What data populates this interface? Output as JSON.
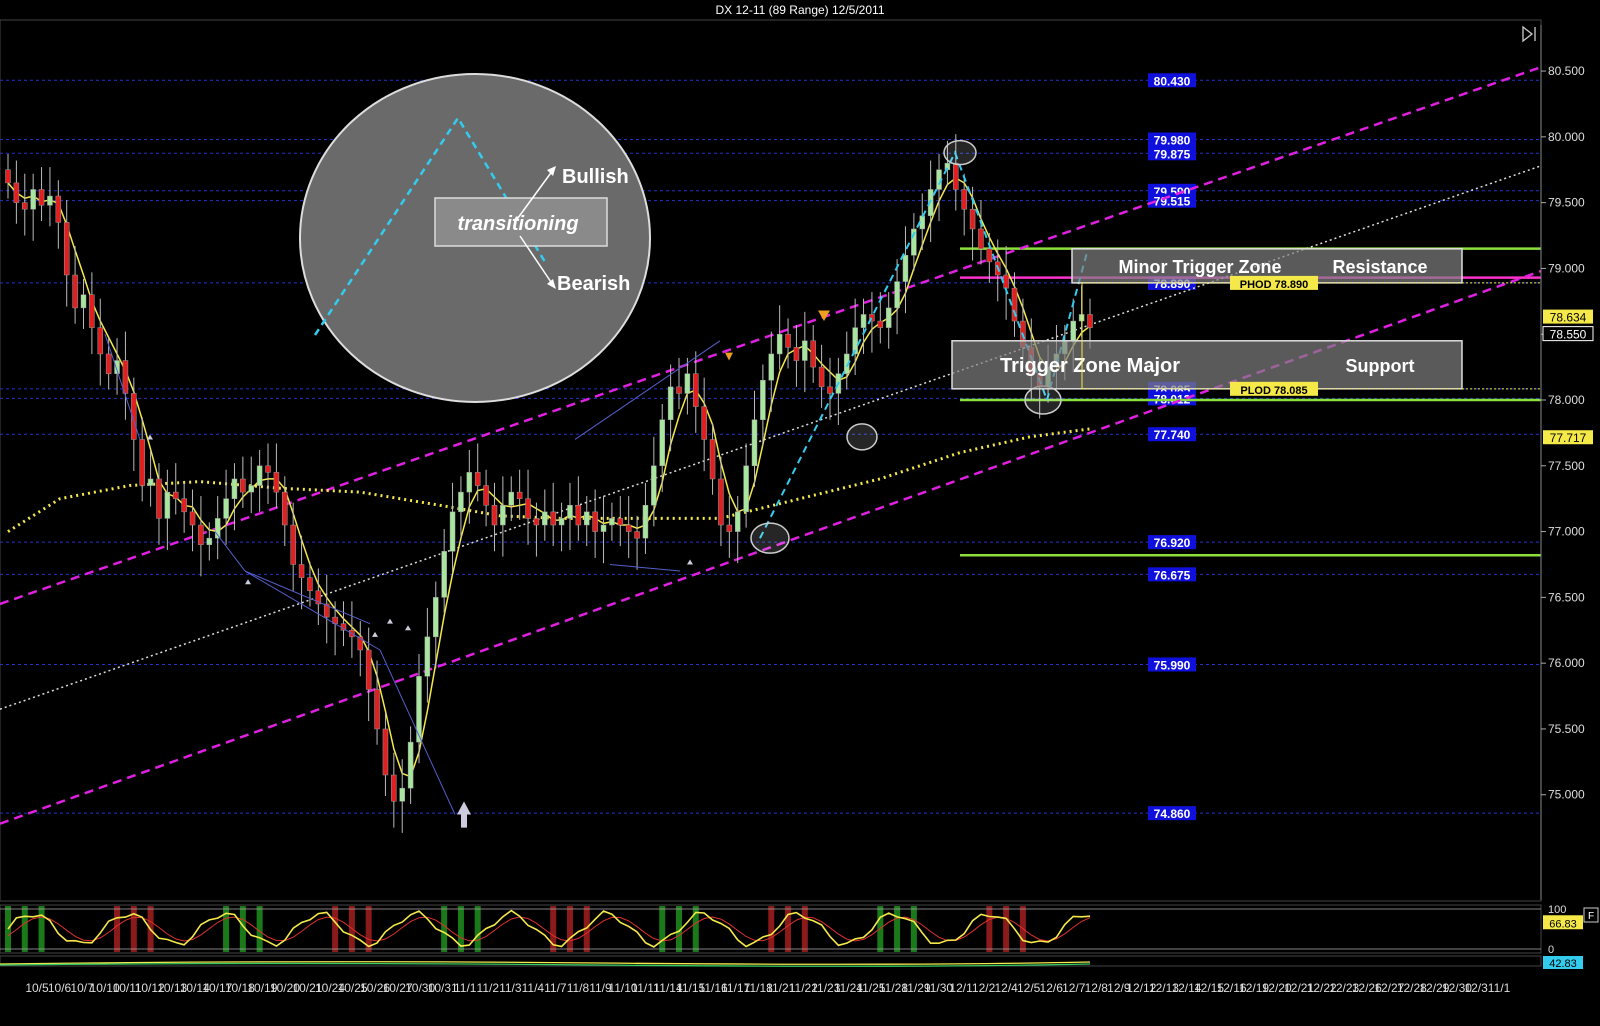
{
  "title": "DX 12-11 (89 Range)  12/5/2011",
  "chart_data": {
    "type": "candlestick",
    "ylim": [
      74.2,
      80.85
    ],
    "y_ticks": [
      "80.500",
      "80.000",
      "79.500",
      "79.000",
      "78.500",
      "78.000",
      "77.500",
      "77.000",
      "76.500",
      "76.000",
      "75.500",
      "75.000"
    ],
    "y_tick_values": [
      80.5,
      80.0,
      79.5,
      79.0,
      78.5,
      78.0,
      77.5,
      77.0,
      76.5,
      76.0,
      75.5,
      75.0
    ],
    "x_ticks": [
      "10/5",
      "10/6",
      "10/7",
      "10/10",
      "10/11",
      "10/12",
      "10/13",
      "10/14",
      "10/17",
      "10/18",
      "10/19",
      "10/20",
      "10/21",
      "10/24",
      "10/25",
      "10/26",
      "10/27",
      "10/30",
      "10/31",
      "11/1",
      "11/2",
      "11/3",
      "11/4",
      "11/7",
      "11/8",
      "11/9",
      "11/10",
      "11/11",
      "11/14",
      "11/15",
      "11/16",
      "11/17",
      "11/18",
      "11/21",
      "11/22",
      "11/23",
      "11/24",
      "11/25",
      "11/28",
      "11/29",
      "11/30",
      "12/1",
      "12/2",
      "12/4",
      "12/5",
      "12/6",
      "12/7",
      "12/8",
      "12/9",
      "12/12",
      "12/13",
      "12/14",
      "12/15",
      "12/16",
      "12/19",
      "12/20",
      "12/21",
      "12/22",
      "12/23",
      "12/26",
      "12/27",
      "12/28",
      "12/29",
      "12/30",
      "12/31",
      "1/1"
    ],
    "x_tick_labels_as_printed": [
      "10/5",
      "10/6",
      "10/7",
      "10/10",
      "10/11",
      "10/12",
      "10/13",
      "10/14",
      "10/17",
      "10/18",
      "10/19",
      "10/20",
      "10/21",
      "10/24",
      "10/25",
      "10/26",
      "10/27",
      "10/30",
      "10/31",
      "11/1",
      "11/2",
      "11/3",
      "11/4",
      "11/7",
      "11/8",
      "11/9",
      "11/10",
      "11/11",
      "11/14",
      "11/15",
      "11/16",
      "11/17",
      "11/18",
      "11/21",
      "11/22",
      "11/23",
      "11/24",
      "11/25",
      "11/28",
      "11/29",
      "11/30",
      "12/1",
      "12/2",
      "12/4",
      "12/5",
      "12/6",
      "12/7",
      "12/8",
      "12/9",
      "12/12",
      "12/13",
      "12/14",
      "12/15",
      "12/16",
      "12/19",
      "12/20",
      "12/21",
      "12/22",
      "12/23",
      "12/26",
      "12/27",
      "12/28",
      "12/29",
      "12/30",
      "12/31",
      "1/1"
    ],
    "level_lines": [
      {
        "label": "80.430",
        "value": 80.43
      },
      {
        "label": "79.980",
        "value": 79.98
      },
      {
        "label": "79.875",
        "value": 79.875
      },
      {
        "label": "79.590",
        "value": 79.59
      },
      {
        "label": "79.515",
        "value": 79.515
      },
      {
        "label": "78.890",
        "value": 78.89
      },
      {
        "label": "78.085",
        "value": 78.085
      },
      {
        "label": "78.012",
        "value": 78.012
      },
      {
        "label": "77.740",
        "value": 77.74
      },
      {
        "label": "76.920",
        "value": 76.92
      },
      {
        "label": "76.675",
        "value": 76.675
      },
      {
        "label": "75.990",
        "value": 75.99
      },
      {
        "label": "74.860",
        "value": 74.86
      }
    ],
    "price_badges": [
      {
        "label": "78.634",
        "value": 78.634
      },
      {
        "label": "78.550",
        "value": 78.55
      },
      {
        "label": "77.717",
        "value": 77.717
      }
    ],
    "zones": [
      {
        "label": "Minor Trigger Zone",
        "side_label": "Resistance",
        "top": 79.15,
        "bottom": 78.89
      },
      {
        "label": "Trigger Zone Major",
        "side_label": "Support",
        "top": 78.45,
        "bottom": 78.085
      }
    ],
    "tags": [
      {
        "label": "PHOD 78.890",
        "value": 78.89
      },
      {
        "label": "PLOD 78.085",
        "value": 78.085
      }
    ],
    "inset": {
      "center_label": "transitioning",
      "up_label": "Bullish",
      "down_label": "Bearish"
    },
    "oscillator": {
      "upper_tick": "100",
      "lower_tick": "0",
      "value_label": "66.83",
      "secondary_label": "42.83",
      "f_button": "F"
    },
    "close_series": [
      79.65,
      79.5,
      79.45,
      79.6,
      79.48,
      79.55,
      79.35,
      78.95,
      78.7,
      78.8,
      78.55,
      78.35,
      78.2,
      78.3,
      78.05,
      77.7,
      77.35,
      77.4,
      77.1,
      77.3,
      77.25,
      77.15,
      77.05,
      76.9,
      76.95,
      77.1,
      77.25,
      77.4,
      77.3,
      77.35,
      77.5,
      77.45,
      77.3,
      77.05,
      76.75,
      76.65,
      76.55,
      76.45,
      76.35,
      76.3,
      76.25,
      76.2,
      76.1,
      75.8,
      75.5,
      75.15,
      74.95,
      75.05,
      75.4,
      75.9,
      76.2,
      76.5,
      76.85,
      77.15,
      77.3,
      77.45,
      77.35,
      77.2,
      77.05,
      77.2,
      77.3,
      77.25,
      77.1,
      77.05,
      77.15,
      77.05,
      77.1,
      77.2,
      77.05,
      77.15,
      77.0,
      77.05,
      77.1,
      77.05,
      77.0,
      76.95,
      77.2,
      77.5,
      77.85,
      78.1,
      78.05,
      78.2,
      77.95,
      77.7,
      77.4,
      77.05,
      77.0,
      77.15,
      77.5,
      77.85,
      78.15,
      78.35,
      78.5,
      78.4,
      78.3,
      78.45,
      78.25,
      78.1,
      78.05,
      78.2,
      78.35,
      78.55,
      78.65,
      78.6,
      78.55,
      78.7,
      78.9,
      79.1,
      79.3,
      79.4,
      79.6,
      79.75,
      79.8,
      79.6,
      79.45,
      79.3,
      79.15,
      79.05,
      78.95,
      78.85,
      78.6,
      78.4,
      78.2,
      78.1,
      78.25,
      78.35,
      78.45,
      78.6,
      78.65,
      78.55
    ]
  }
}
